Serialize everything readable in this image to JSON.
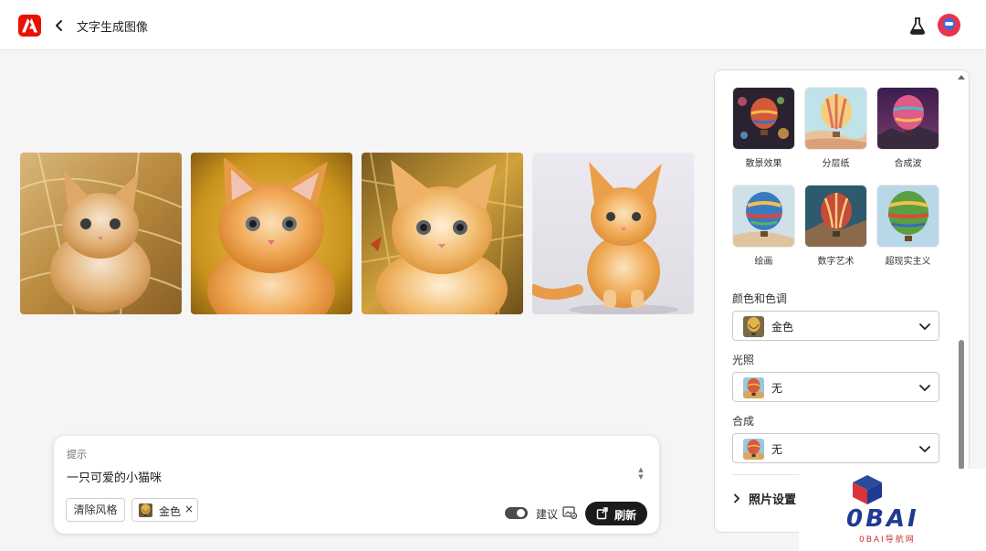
{
  "header": {
    "title": "文字生成图像",
    "icons": {
      "logo": "adobe-logo",
      "back": "chevron-left-icon",
      "labs": "flask-icon",
      "avatar": "user-avatar"
    }
  },
  "gallery": {
    "images": [
      {
        "subject": "kitten-in-straw"
      },
      {
        "subject": "kitten-golden-tinsel"
      },
      {
        "subject": "kitten-golden-grass"
      },
      {
        "subject": "kitten-white-background"
      }
    ]
  },
  "prompt": {
    "label": "提示",
    "text": "一只可爱的小猫咪",
    "clear_style": "清除风格",
    "chip_label": "金色",
    "chip_close": "×",
    "suggest_label": "建议",
    "suggest_enabled": true,
    "refresh_label": "刷新"
  },
  "side_panel": {
    "styles": [
      {
        "label": "散景效果"
      },
      {
        "label": "分层纸"
      },
      {
        "label": "合成波"
      },
      {
        "label": "绘画"
      },
      {
        "label": "数字艺术"
      },
      {
        "label": "超现实主义"
      }
    ],
    "color_tone": {
      "label": "颜色和色调",
      "value": "金色"
    },
    "lighting": {
      "label": "光照",
      "value": "无"
    },
    "composition": {
      "label": "合成",
      "value": "无"
    },
    "photo_settings": "照片设置"
  },
  "watermark": {
    "brand": "0BAI",
    "sub": "0BAI导航网"
  },
  "colors": {
    "adobe_red": "#eb1000",
    "refresh_bg": "#1b1b1b",
    "toggle_on": "#4b4b4b",
    "watermark_blue": "#1f3a93",
    "watermark_red": "#c9302c"
  }
}
